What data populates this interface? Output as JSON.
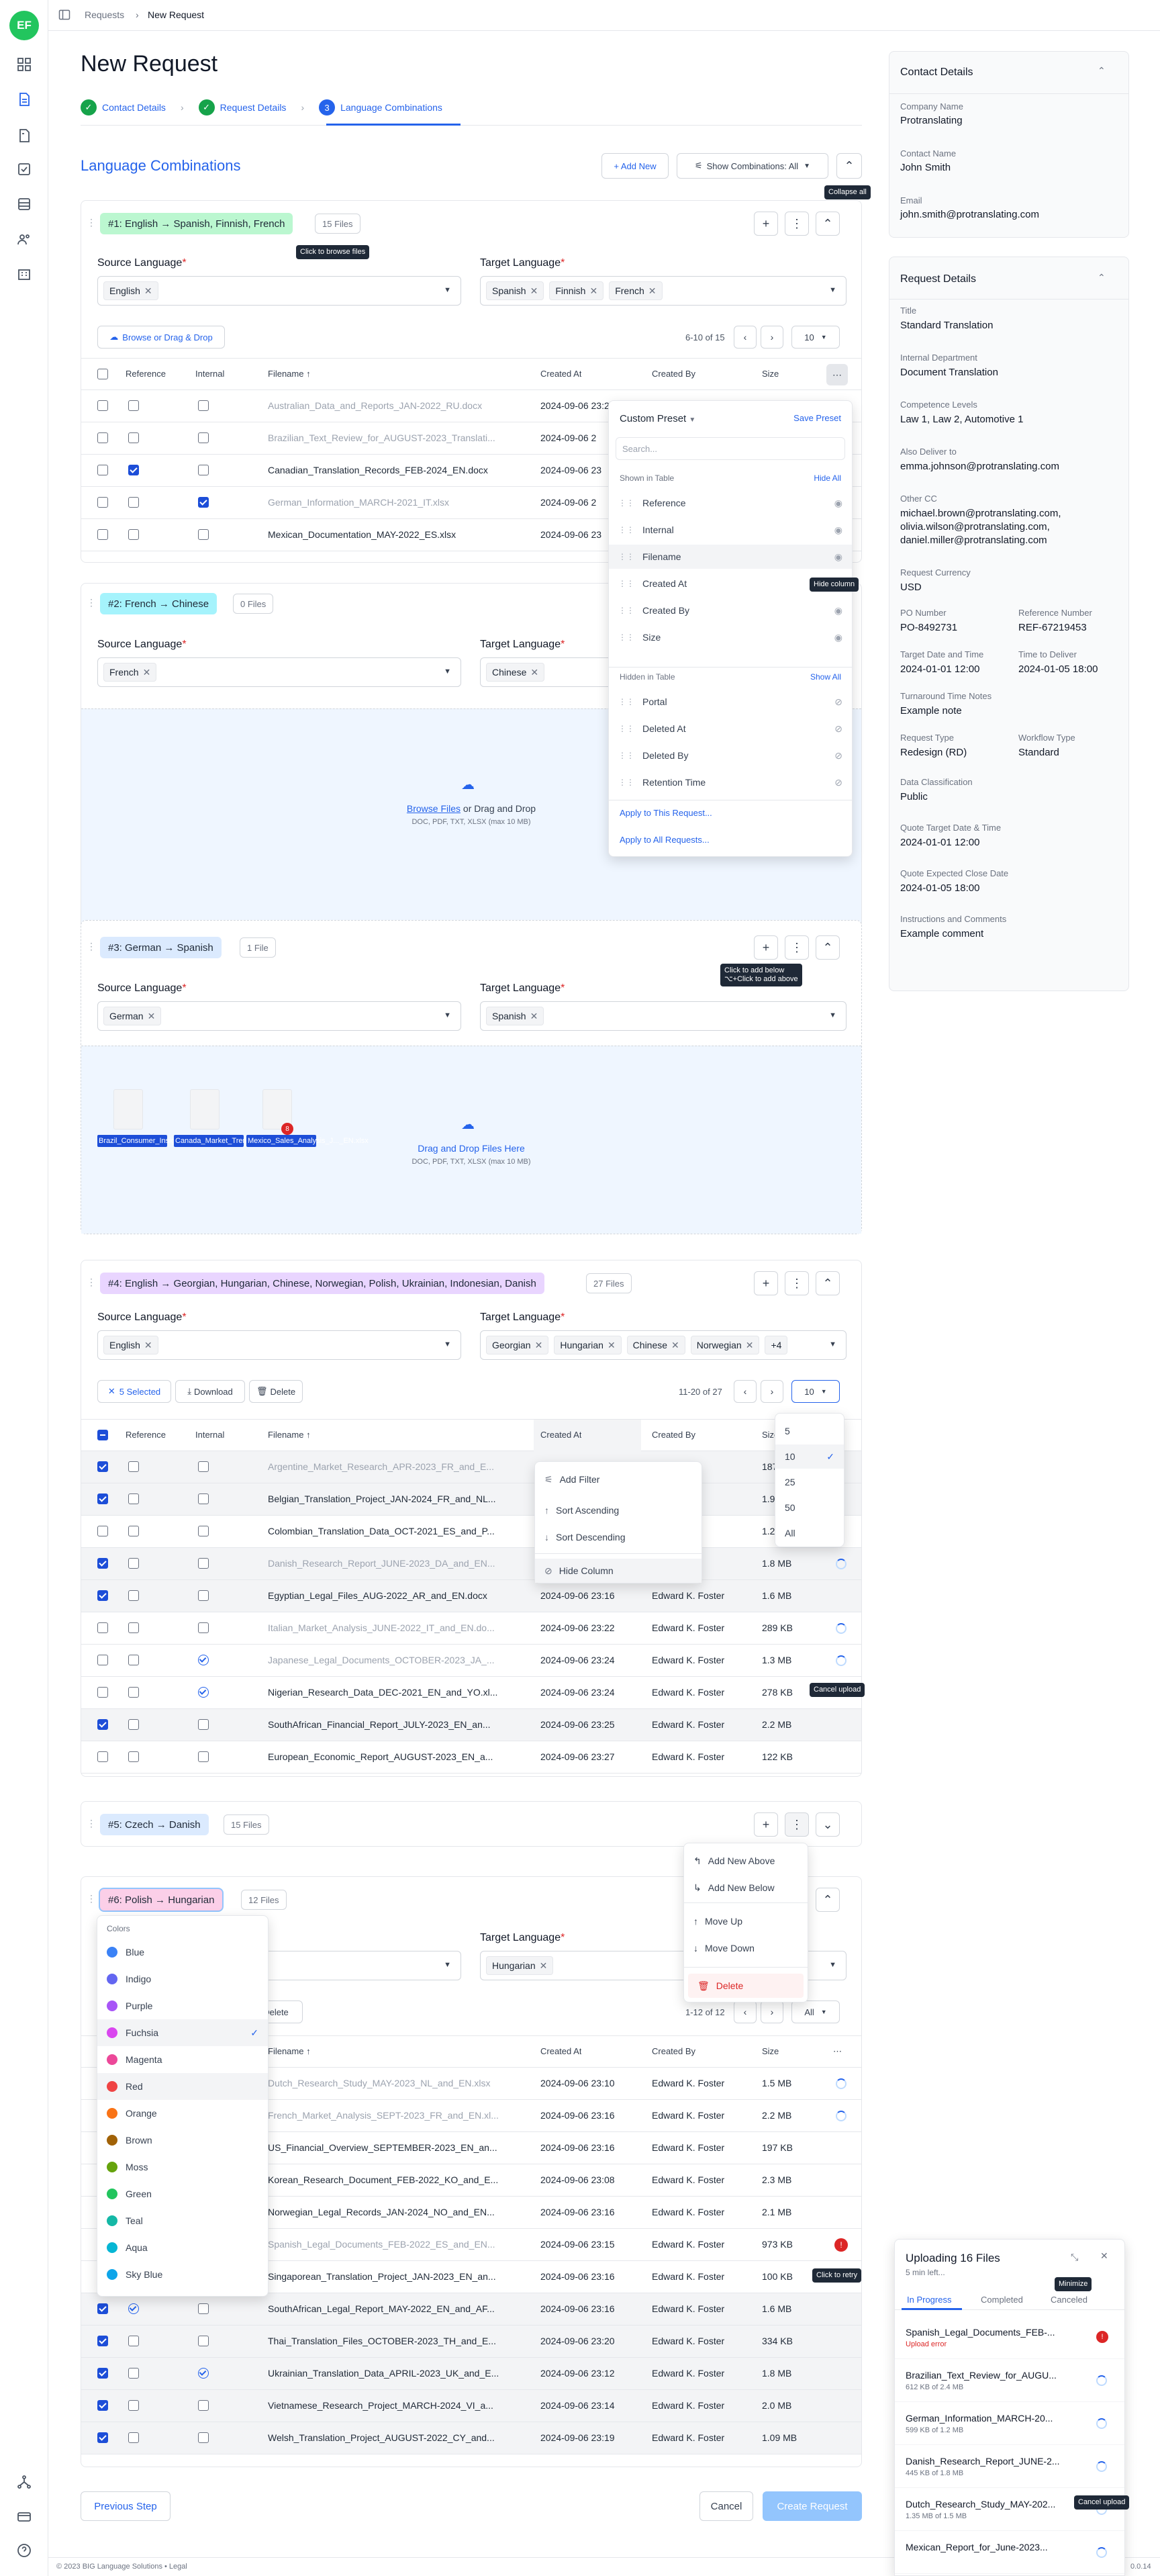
{
  "app": {
    "avatar": "EF",
    "footer": "© 2023 BIG Language Solutions • Legal",
    "version": "0.0.14"
  },
  "breadcrumb": {
    "parent": "Requests",
    "current": "New Request"
  },
  "page": {
    "title": "New Request",
    "section_title": "Language Combinations"
  },
  "steps": [
    {
      "label": "Contact Details",
      "state": "done"
    },
    {
      "label": "Request Details",
      "state": "done"
    },
    {
      "num": "3",
      "label": "Language Combinations",
      "state": "current"
    }
  ],
  "toolbar": {
    "add_new": "+ Add New",
    "show_combinations": "Show Combinations: All",
    "collapse_tip": "Collapse all"
  },
  "common": {
    "source_label": "Source Language",
    "target_label": "Target Language",
    "browse": "Browse or Drag & Drop",
    "th_reference": "Reference",
    "th_internal": "Internal",
    "th_filename": "Filename ↑",
    "th_created_at": "Created At",
    "th_created_by": "Created By",
    "th_size": "Size",
    "per_page": "10",
    "drop_browse": "Browse Files",
    "drop_rest": " or Drag and Drop",
    "drop_hint": "DOC, PDF, TXT, XLSX (max 10 MB)",
    "drop_here": "Drag and Drop Files Here"
  },
  "combos": [
    {
      "tag": "#1: English → Spanish, Finnish, French",
      "tag_color": "#bbf7d0",
      "count": "15 Files",
      "count_tip": "Click to browse files",
      "source": [
        "English"
      ],
      "targets": [
        "Spanish",
        "Finnish",
        "French"
      ],
      "pager": "6-10 of 15",
      "rows": [
        {
          "file": "Australian_Data_and_Reports_JAN-2022_RU.docx",
          "date": "2024-09-06 23:2",
          "muted": true,
          "ref": false,
          "int": false,
          "sel": false
        },
        {
          "file": "Brazilian_Text_Review_for_AUGUST-2023_Translati...",
          "date": "2024-09-06 2",
          "muted": true,
          "ref": false,
          "int": false,
          "sel": false
        },
        {
          "file": "Canadian_Translation_Records_FEB-2024_EN.docx",
          "date": "2024-09-06 23",
          "muted": false,
          "ref": true,
          "int": false,
          "sel": false
        },
        {
          "file": "German_Information_MARCH-2021_IT.xlsx",
          "date": "2024-09-06 2",
          "muted": true,
          "ref": false,
          "int": true,
          "sel": false
        },
        {
          "file": "Mexican_Documentation_MAY-2022_ES.xlsx",
          "date": "2024-09-06 23",
          "muted": false,
          "ref": false,
          "int": false,
          "sel": false
        }
      ]
    },
    {
      "tag": "#2: French → Chinese",
      "tag_color": "#a5f3fc",
      "count": "0 Files",
      "source": [
        "French"
      ],
      "targets": [
        "Chinese"
      ]
    },
    {
      "tag": "#3: German → Spanish",
      "tag_color": "#dbeafe",
      "count": "1 File",
      "source": [
        "German"
      ],
      "targets": [
        "Spanish"
      ],
      "add_tip": "Click to add below\n⌥+Click to add above",
      "thumbs": [
        "Brazil_Consumer_Insights...EN.xlsx",
        "Canada_Market_Trends_D...EN.xlsx",
        "Mexico_Sales_Analysis_J..._EN.xlsx"
      ],
      "badge": "8"
    },
    {
      "tag": "#4: English → Georgian, Hungarian, Chinese, Norwegian, Polish, Ukrainian, Indonesian, Danish",
      "tag_color": "#e9d5ff",
      "count": "27 Files",
      "source": [
        "English"
      ],
      "targets": [
        "Georgian",
        "Hungarian",
        "Chinese",
        "Norwegian"
      ],
      "more": "+4",
      "selected": "5 Selected",
      "download": "Download",
      "delete": "Delete",
      "pager": "11-20 of 27",
      "rows": [
        {
          "file": "Argentine_Market_Research_APR-2023_FR_and_E...",
          "date": "",
          "by": "oster",
          "size": "187",
          "muted": true,
          "sel": true,
          "ref": false,
          "int": false
        },
        {
          "file": "Belgian_Translation_Project_JAN-2024_FR_and_NL...",
          "date": "",
          "by": "oster",
          "size": "1.9",
          "muted": false,
          "sel": true,
          "ref": false,
          "int": false
        },
        {
          "file": "Colombian_Translation_Data_OCT-2021_ES_and_P...",
          "date": "",
          "by": "oster",
          "size": "1.2",
          "muted": false,
          "sel": false,
          "ref": false,
          "int": false
        },
        {
          "file": "Danish_Research_Report_JUNE-2023_DA_and_EN...",
          "date": "",
          "by": "oster",
          "size": "1.8 MB",
          "muted": true,
          "sel": true,
          "ref": false,
          "int": false
        },
        {
          "file": "Egyptian_Legal_Files_AUG-2022_AR_and_EN.docx",
          "date": "2024-09-06 23:16",
          "by": "Edward K. Foster",
          "size": "1.6 MB",
          "muted": false,
          "sel": true,
          "ref": false,
          "int": false
        },
        {
          "file": "Italian_Market_Analysis_JUNE-2022_IT_and_EN.do...",
          "date": "2024-09-06 23:22",
          "by": "Edward K. Foster",
          "size": "289 KB",
          "muted": true,
          "sel": false,
          "ref": false,
          "int": false
        },
        {
          "file": "Japanese_Legal_Documents_OCTOBER-2023_JA_...",
          "date": "2024-09-06 23:24",
          "by": "Edward K. Foster",
          "size": "1.3 MB",
          "muted": true,
          "sel": false,
          "ref": false,
          "int": true
        },
        {
          "file": "Nigerian_Research_Data_DEC-2021_EN_and_YO.xl...",
          "date": "2024-09-06 23:24",
          "by": "Edward K. Foster",
          "size": "278 KB",
          "muted": false,
          "sel": false,
          "ref": false,
          "int": true
        },
        {
          "file": "SouthAfrican_Financial_Report_JULY-2023_EN_an...",
          "date": "2024-09-06 23:25",
          "by": "Edward K. Foster",
          "size": "2.2 MB",
          "muted": false,
          "sel": true,
          "ref": false,
          "int": false
        },
        {
          "file": "European_Economic_Report_AUGUST-2023_EN_a...",
          "date": "2024-09-06 23:27",
          "by": "Edward K. Foster",
          "size": "122 KB",
          "muted": false,
          "sel": false,
          "ref": false,
          "int": false
        }
      ]
    },
    {
      "tag": "#5: Czech → Danish",
      "tag_color": "#dbeafe",
      "count": "15 Files"
    },
    {
      "tag": "#6: Polish → Hungarian",
      "tag_color": "#fbcfe8",
      "count": "12 Files",
      "targets": [
        "Hungarian"
      ],
      "delete": "Delete",
      "pager": "1-12 of 12",
      "per_page": "All",
      "rows": [
        {
          "file": "Dutch_Research_Study_MAY-2023_NL_and_EN.xlsx",
          "date": "2024-09-06 23:10",
          "by": "Edward K. Foster",
          "size": "1.5 MB",
          "muted": true,
          "sel": false
        },
        {
          "file": "French_Market_Analysis_SEPT-2023_FR_and_EN.xl...",
          "date": "2024-09-06 23:16",
          "by": "Edward K. Foster",
          "size": "2.2 MB",
          "muted": true,
          "sel": false
        },
        {
          "file": "US_Financial_Overview_SEPTEMBER-2023_EN_an...",
          "date": "2024-09-06 23:16",
          "by": "Edward K. Foster",
          "size": "197 KB",
          "muted": false,
          "sel": false
        },
        {
          "file": "Korean_Research_Document_FEB-2022_KO_and_E...",
          "date": "2024-09-06 23:08",
          "by": "Edward K. Foster",
          "size": "2.3 MB",
          "muted": false,
          "sel": false
        },
        {
          "file": "Norwegian_Legal_Records_JAN-2024_NO_and_EN...",
          "date": "2024-09-06 23:16",
          "by": "Edward K. Foster",
          "size": "2.1 MB",
          "muted": false,
          "sel": false
        },
        {
          "file": "Spanish_Legal_Documents_FEB-2022_ES_and_EN...",
          "date": "2024-09-06 23:15",
          "by": "Edward K. Foster",
          "size": "973 KB",
          "muted": true,
          "sel": false
        },
        {
          "file": "Singaporean_Translation_Project_JAN-2023_EN_an...",
          "date": "2024-09-06 23:16",
          "by": "Edward K. Foster",
          "size": "100 KB",
          "muted": false,
          "sel": false
        },
        {
          "file": "SouthAfrican_Legal_Report_MAY-2022_EN_and_AF...",
          "date": "2024-09-06 23:16",
          "by": "Edward K. Foster",
          "size": "1.6 MB",
          "muted": false,
          "sel": true,
          "ref": true
        },
        {
          "file": "Thai_Translation_Files_OCTOBER-2023_TH_and_E...",
          "date": "2024-09-06 23:20",
          "by": "Edward K. Foster",
          "size": "334 KB",
          "muted": false,
          "sel": true
        },
        {
          "file": "Ukrainian_Translation_Data_APRIL-2023_UK_and_E...",
          "date": "2024-09-06 23:12",
          "by": "Edward K. Foster",
          "size": "1.8 MB",
          "muted": false,
          "sel": true,
          "int": true
        },
        {
          "file": "Vietnamese_Research_Project_MARCH-2024_VI_a...",
          "date": "2024-09-06 23:14",
          "by": "Edward K. Foster",
          "size": "2.0 MB",
          "muted": false,
          "sel": true
        },
        {
          "file": "Welsh_Translation_Project_AUGUST-2022_CY_and...",
          "date": "2024-09-06 23:19",
          "by": "Edward K. Foster",
          "size": "1.09 MB",
          "muted": false,
          "sel": true
        }
      ]
    }
  ],
  "column_menu": {
    "preset": "Custom Preset",
    "save": "Save Preset",
    "search": "Search...",
    "shown_title": "Shown in Table",
    "hide_all": "Hide All",
    "shown": [
      "Reference",
      "Internal",
      "Filename",
      "Created At",
      "Created By",
      "Size"
    ],
    "hidden_title": "Hidden in Table",
    "show_all": "Show All",
    "hidden": [
      "Portal",
      "Deleted At",
      "Deleted By",
      "Retention Time"
    ],
    "apply_request": "Apply to This Request...",
    "apply_all": "Apply to All Requests...",
    "hide_col_tip": "Hide column"
  },
  "header_menu": {
    "items": [
      "Add Filter",
      "Sort Ascending",
      "Sort Descending",
      "Hide Column"
    ]
  },
  "perpage_menu": {
    "options": [
      "5",
      "10",
      "25",
      "50",
      "All"
    ],
    "selected": "10"
  },
  "row_menu": {
    "items": [
      "Add New Above",
      "Add New Below",
      "Move Up",
      "Move Down",
      "Delete"
    ]
  },
  "color_menu": {
    "title": "Colors",
    "items": [
      {
        "name": "Blue",
        "hex": "#3b82f6"
      },
      {
        "name": "Indigo",
        "hex": "#6366f1"
      },
      {
        "name": "Purple",
        "hex": "#a855f7"
      },
      {
        "name": "Fuchsia",
        "hex": "#d946ef"
      },
      {
        "name": "Magenta",
        "hex": "#ec4899"
      },
      {
        "name": "Red",
        "hex": "#ef4444"
      },
      {
        "name": "Orange",
        "hex": "#f97316"
      },
      {
        "name": "Brown",
        "hex": "#a16207"
      },
      {
        "name": "Moss",
        "hex": "#65a30d"
      },
      {
        "name": "Green",
        "hex": "#22c55e"
      },
      {
        "name": "Teal",
        "hex": "#14b8a6"
      },
      {
        "name": "Aqua",
        "hex": "#06b6d4"
      },
      {
        "name": "Sky Blue",
        "hex": "#0ea5e9"
      }
    ],
    "selected": "Fuchsia"
  },
  "tips": {
    "cancel_upload": "Cancel upload",
    "retry": "Click to retry",
    "minimize": "Minimize"
  },
  "contact": {
    "title": "Contact Details",
    "company_label": "Company Name",
    "company": "Protranslating",
    "contact_label": "Contact Name",
    "contact": "John Smith",
    "email_label": "Email",
    "email": "john.smith@protranslating.com"
  },
  "request": {
    "title": "Request Details",
    "fields": [
      {
        "label": "Title",
        "value": "Standard Translation"
      },
      {
        "label": "Internal Department",
        "value": "Document Translation"
      },
      {
        "label": "Competence Levels",
        "value": "Law 1, Law 2, Automotive 1"
      },
      {
        "label": "Also Deliver to",
        "value": "emma.johnson@protranslating.com"
      },
      {
        "label": "Other CC",
        "value": "michael.brown@protranslating.com,\nolivia.wilson@protranslating.com,\ndaniel.miller@protranslating.com"
      },
      {
        "label": "Request Currency",
        "value": "USD"
      }
    ],
    "pairs": [
      {
        "l1": "PO Number",
        "v1": "PO-8492731",
        "l2": "Reference Number",
        "v2": "REF-67219453"
      },
      {
        "l1": "Target Date and Time",
        "v1": "2024-01-01 12:00",
        "l2": "Time to Deliver",
        "v2": "2024-01-05 18:00"
      }
    ],
    "fields2": [
      {
        "label": "Turnaround Time Notes",
        "value": "Example note"
      }
    ],
    "pair3": {
      "l1": "Request Type",
      "v1": "Redesign (RD)",
      "l2": "Workflow Type",
      "v2": "Standard"
    },
    "fields3": [
      {
        "label": "Data Classification",
        "value": "Public"
      },
      {
        "label": "Quote Target Date & Time",
        "value": "2024-01-01 12:00"
      },
      {
        "label": "Quote Expected Close Date",
        "value": "2024-01-05 18:00"
      },
      {
        "label": "Instructions and Comments",
        "value": "Example comment"
      }
    ]
  },
  "upload": {
    "title": "Uploading 16 Files",
    "sub": "5 min left...",
    "tabs": [
      "In Progress",
      "Completed",
      "Canceled"
    ],
    "items": [
      {
        "name": "Spanish_Legal_Documents_FEB-...",
        "status": "Upload error",
        "state": "error"
      },
      {
        "name": "Brazilian_Text_Review_for_AUGU...",
        "status": "612 KB of 2.4 MB",
        "state": "loading"
      },
      {
        "name": "German_Information_MARCH-20...",
        "status": "599 KB of 1.2 MB",
        "state": "loading"
      },
      {
        "name": "Danish_Research_Report_JUNE-2...",
        "status": "445 KB of 1.8 MB",
        "state": "cancel"
      },
      {
        "name": "Dutch_Research_Study_MAY-202...",
        "status": "1.35 MB of 1.5 MB",
        "state": "loading"
      },
      {
        "name": "Mexican_Report_for_June-2023...",
        "status": "",
        "state": "loading"
      }
    ]
  },
  "footer_buttons": {
    "previous": "Previous Step",
    "cancel": "Cancel",
    "create": "Create Request"
  },
  "colors": {
    "accent": "#2563eb",
    "success": "#16a34a",
    "danger": "#dc2626"
  }
}
